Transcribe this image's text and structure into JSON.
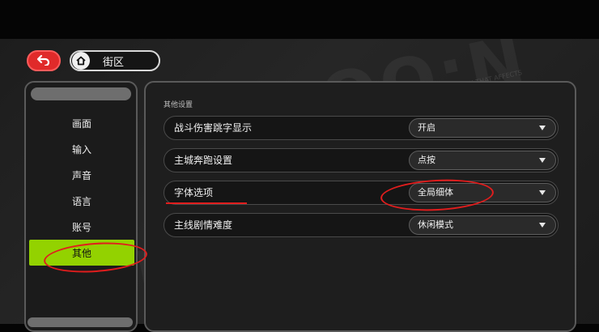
{
  "header": {
    "breadcrumb": "街区"
  },
  "sidebar": {
    "items": [
      {
        "label": "画面",
        "active": false
      },
      {
        "label": "输入",
        "active": false
      },
      {
        "label": "声音",
        "active": false
      },
      {
        "label": "语言",
        "active": false
      },
      {
        "label": "账号",
        "active": false
      },
      {
        "label": "其他",
        "active": true
      }
    ]
  },
  "main": {
    "section_title": "其他设置",
    "settings": [
      {
        "label": "战斗伤害跳字显示",
        "value": "开启"
      },
      {
        "label": "主城奔跑设置",
        "value": "点按"
      },
      {
        "label": "字体选项",
        "value": "全局细体"
      },
      {
        "label": "主线剧情难度",
        "value": "休闲模式"
      }
    ]
  },
  "colors": {
    "accent": "#93d200",
    "back": "#e02a2a",
    "annotation": "#e11d1d"
  }
}
